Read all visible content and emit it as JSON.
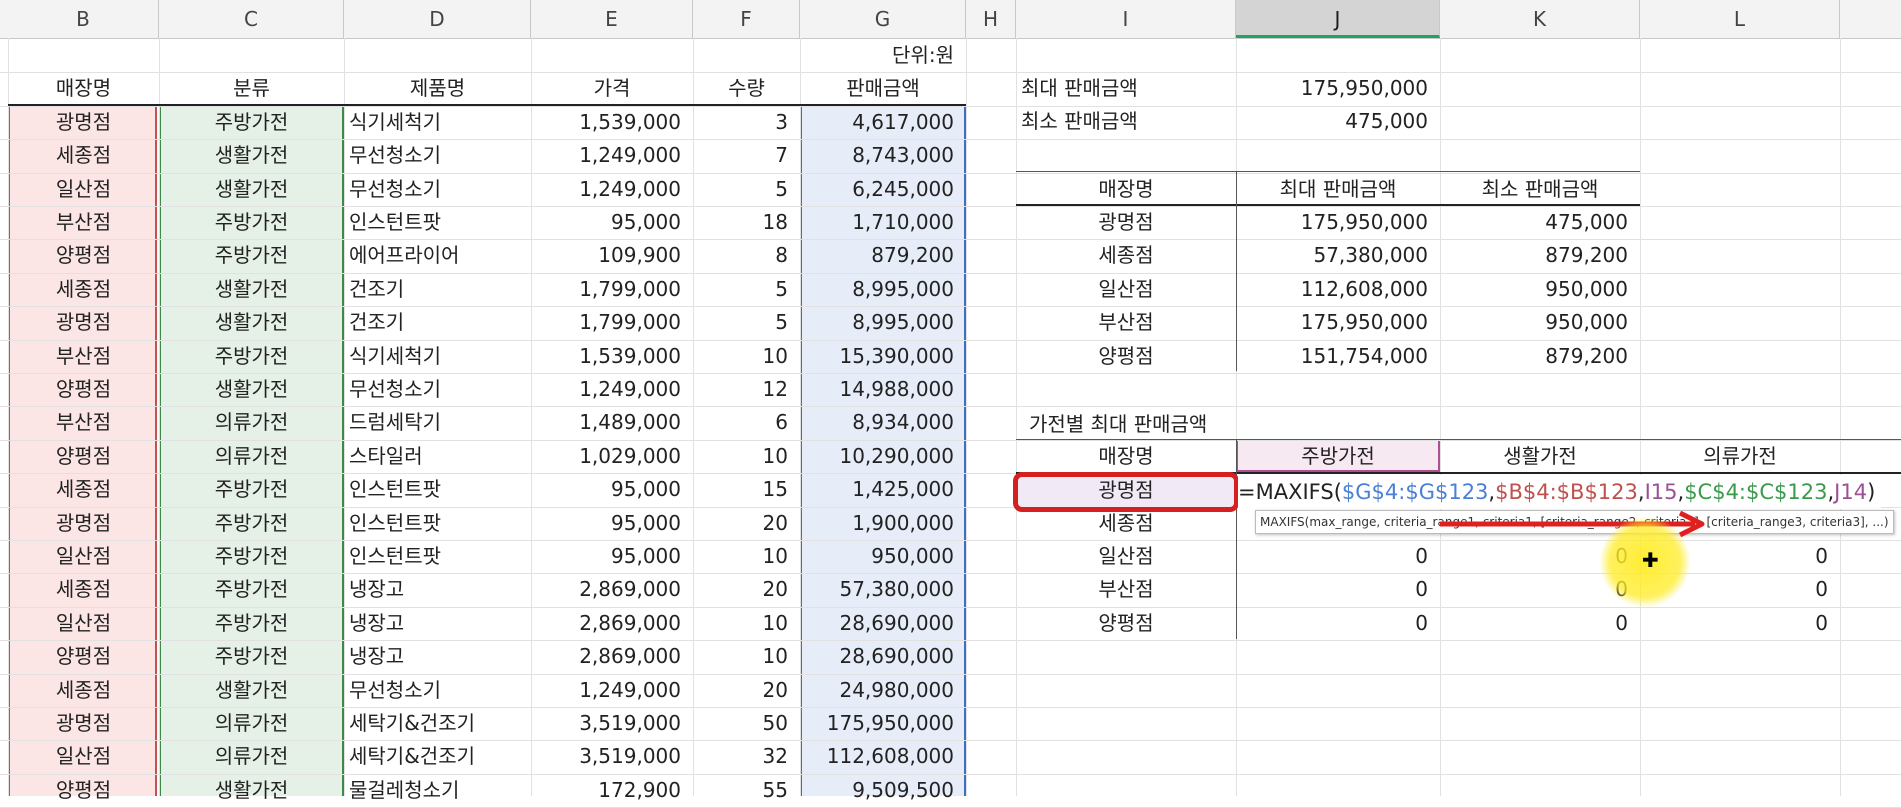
{
  "columns": [
    "B",
    "C",
    "D",
    "E",
    "F",
    "G",
    "H",
    "I",
    "J",
    "K",
    "L"
  ],
  "unit_label": "단위:원",
  "table": {
    "headers": [
      "매장명",
      "분류",
      "제품명",
      "가격",
      "수량",
      "판매금액"
    ],
    "rows": [
      [
        "광명점",
        "주방가전",
        "식기세척기",
        "1,539,000",
        "3",
        "4,617,000"
      ],
      [
        "세종점",
        "생활가전",
        "무선청소기",
        "1,249,000",
        "7",
        "8,743,000"
      ],
      [
        "일산점",
        "생활가전",
        "무선청소기",
        "1,249,000",
        "5",
        "6,245,000"
      ],
      [
        "부산점",
        "주방가전",
        "인스턴트팟",
        "95,000",
        "18",
        "1,710,000"
      ],
      [
        "양평점",
        "주방가전",
        "에어프라이어",
        "109,900",
        "8",
        "879,200"
      ],
      [
        "세종점",
        "생활가전",
        "건조기",
        "1,799,000",
        "5",
        "8,995,000"
      ],
      [
        "광명점",
        "생활가전",
        "건조기",
        "1,799,000",
        "5",
        "8,995,000"
      ],
      [
        "부산점",
        "주방가전",
        "식기세척기",
        "1,539,000",
        "10",
        "15,390,000"
      ],
      [
        "양평점",
        "생활가전",
        "무선청소기",
        "1,249,000",
        "12",
        "14,988,000"
      ],
      [
        "부산점",
        "의류가전",
        "드럼세탁기",
        "1,489,000",
        "6",
        "8,934,000"
      ],
      [
        "양평점",
        "의류가전",
        "스타일러",
        "1,029,000",
        "10",
        "10,290,000"
      ],
      [
        "세종점",
        "주방가전",
        "인스턴트팟",
        "95,000",
        "15",
        "1,425,000"
      ],
      [
        "광명점",
        "주방가전",
        "인스턴트팟",
        "95,000",
        "20",
        "1,900,000"
      ],
      [
        "일산점",
        "주방가전",
        "인스턴트팟",
        "95,000",
        "10",
        "950,000"
      ],
      [
        "세종점",
        "주방가전",
        "냉장고",
        "2,869,000",
        "20",
        "57,380,000"
      ],
      [
        "일산점",
        "주방가전",
        "냉장고",
        "2,869,000",
        "10",
        "28,690,000"
      ],
      [
        "양평점",
        "주방가전",
        "냉장고",
        "2,869,000",
        "10",
        "28,690,000"
      ],
      [
        "세종점",
        "생활가전",
        "무선청소기",
        "1,249,000",
        "20",
        "24,980,000"
      ],
      [
        "광명점",
        "의류가전",
        "세탁기&건조기",
        "3,519,000",
        "50",
        "175,950,000"
      ],
      [
        "일산점",
        "의류가전",
        "세탁기&건조기",
        "3,519,000",
        "32",
        "112,608,000"
      ],
      [
        "양평점",
        "생활가전",
        "물걸레청소기",
        "172,900",
        "55",
        "9,509,500"
      ]
    ]
  },
  "summary": {
    "max_label": "최대 판매금액",
    "max_value": "175,950,000",
    "min_label": "최소 판매금액",
    "min_value": "475,000"
  },
  "store_table": {
    "headers": [
      "매장명",
      "최대 판매금액",
      "최소 판매금액"
    ],
    "rows": [
      [
        "광명점",
        "175,950,000",
        "475,000"
      ],
      [
        "세종점",
        "57,380,000",
        "879,200"
      ],
      [
        "일산점",
        "112,608,000",
        "950,000"
      ],
      [
        "부산점",
        "175,950,000",
        "950,000"
      ],
      [
        "양평점",
        "151,754,000",
        "879,200"
      ]
    ]
  },
  "category_table": {
    "title": "가전별 최대 판매금액",
    "headers": [
      "매장명",
      "주방가전",
      "생활가전",
      "의류가전"
    ],
    "stores": [
      "광명점",
      "세종점",
      "일산점",
      "부산점",
      "양평점"
    ],
    "values": [
      [
        "",
        "",
        ""
      ],
      [
        "",
        "",
        ""
      ],
      [
        "0",
        "0",
        "0"
      ],
      [
        "0",
        "0",
        "0"
      ],
      [
        "0",
        "0",
        "0"
      ]
    ]
  },
  "formula": {
    "prefix": "=MAXIFS(",
    "ref1": "$G$4:$G$123",
    "sep": ",",
    "ref2": "$B$4:$B$123",
    "crit1": "I15",
    "ref3": "$C$4:$C$123",
    "crit2": "J14",
    "suffix": ")",
    "colors": {
      "ref1": "#4a7fd6",
      "ref2": "#c0504d",
      "ref3": "#3a9a4c",
      "ref4": "#9b4f96"
    }
  },
  "tooltip": "MAXIFS(max_range, criteria_range1, criteria1, [criteria_range2, criteria2], [criteria_range3, criteria3], ...)"
}
